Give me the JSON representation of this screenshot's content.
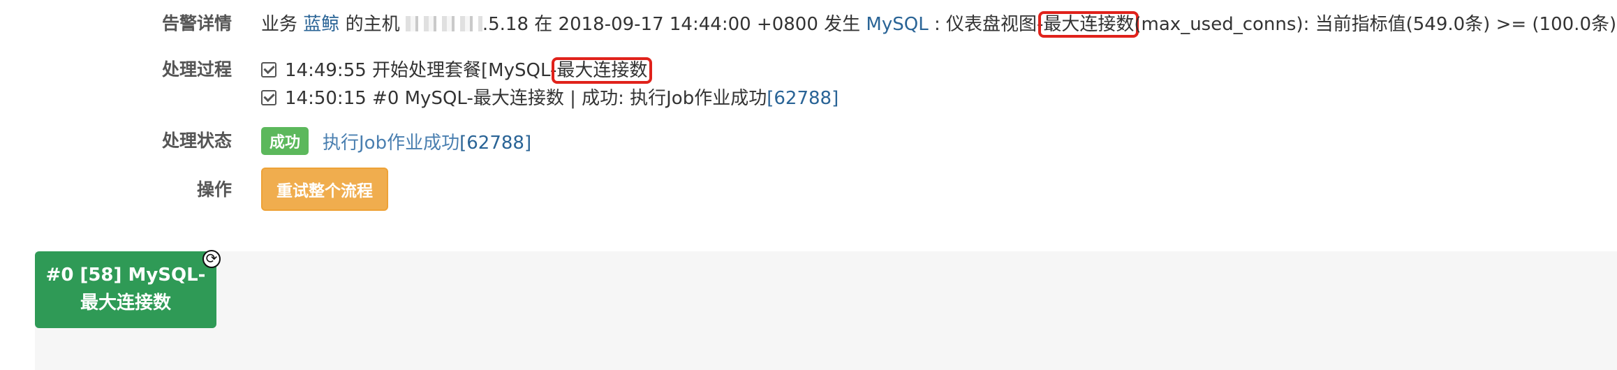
{
  "alert": {
    "label": "告警详情",
    "prefix": "业务",
    "business": "蓝鲸",
    "host_text": "的主机",
    "ip_tail": ".5.18",
    "mid": "在 2018-09-17 14:44:00 +0800 发生",
    "source": "MySQL",
    "desc_a": ": 仪表盘视图-",
    "desc_hl": "最大连接数",
    "desc_b": "(max_used_conns): 当前指标值(549.0条) >= (100.0条)"
  },
  "process": {
    "label": "处理过程",
    "line1_a": "14:49:55 开始处理套餐[MySQL-",
    "line1_hl": "最大连接数",
    "line2_a": "14:50:15 #0 MySQL-最大连接数 | 成功: 执行Job作业成功",
    "line2_id": "[62788]"
  },
  "status": {
    "label": "处理状态",
    "badge": "成功",
    "text": "执行Job作业成功",
    "id": "[62788]"
  },
  "operation": {
    "label": "操作",
    "retry_button": "重试整个流程"
  },
  "flow": {
    "node_line1": "#0 [58] MySQL-",
    "node_line2": "最大连接数",
    "icon": "sync-icon"
  }
}
